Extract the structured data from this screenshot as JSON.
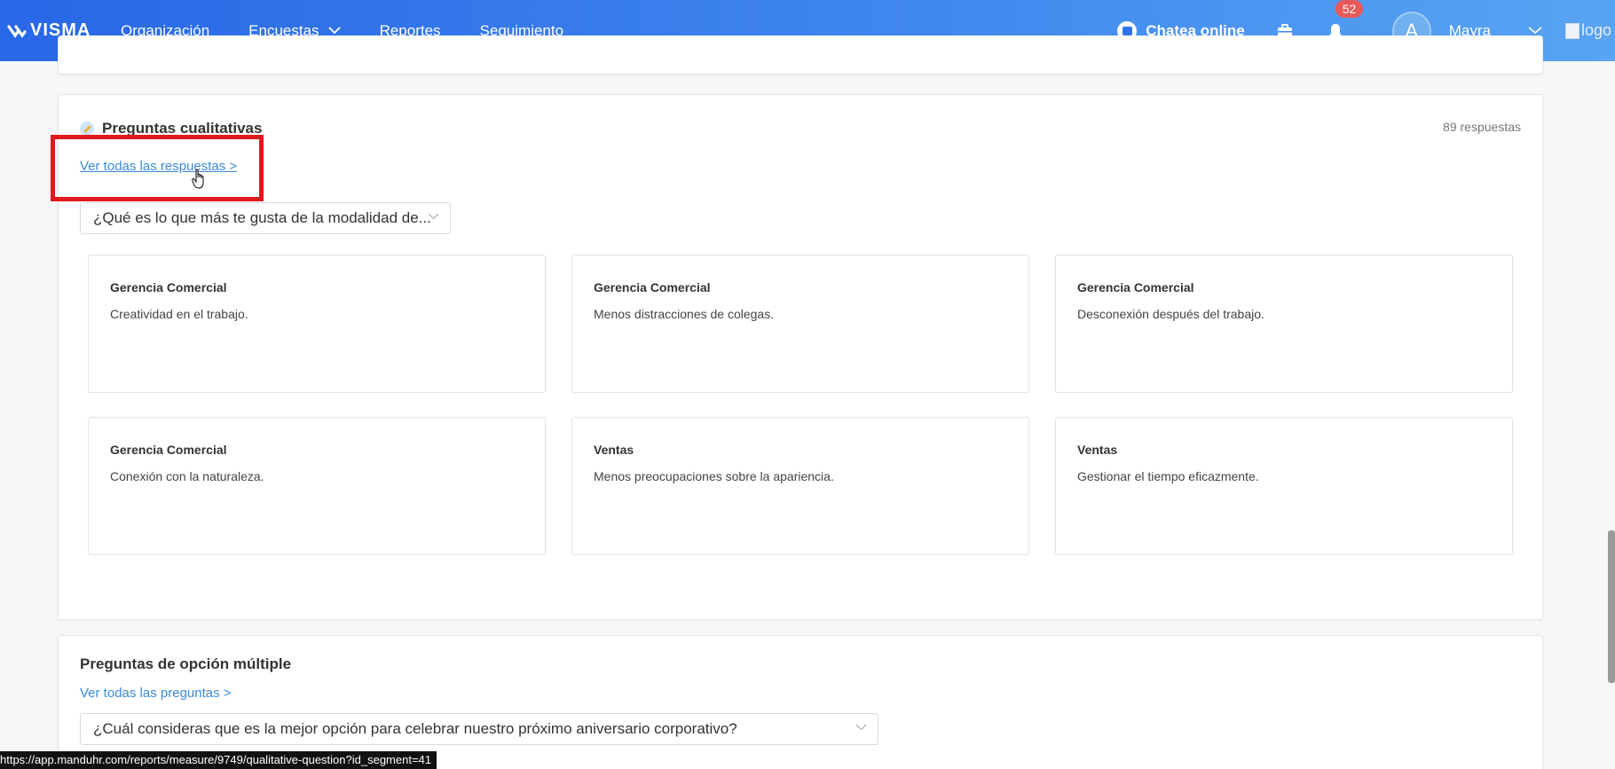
{
  "nav": {
    "brand": "VISMA",
    "items": [
      {
        "label": "Organización",
        "has_dropdown": false
      },
      {
        "label": "Encuestas",
        "has_dropdown": true
      },
      {
        "label": "Reportes",
        "has_dropdown": false
      },
      {
        "label": "Seguimiento",
        "has_dropdown": false
      }
    ],
    "chat_label": "Chatea online",
    "notification_count": "52",
    "avatar_initial": "A",
    "user_name": "Mayra",
    "logo_alt": "logo"
  },
  "qualitative": {
    "title": "Preguntas cualitativas",
    "count": "89 respuestas",
    "link": "Ver todas las respuestas >",
    "question": "¿Qué es lo que más te gusta de la modalidad de...",
    "answers": [
      {
        "dept": "Gerencia Comercial",
        "text": "Creatividad en el trabajo."
      },
      {
        "dept": "Gerencia Comercial",
        "text": "Menos distracciones de colegas."
      },
      {
        "dept": "Gerencia Comercial",
        "text": "Desconexión después del trabajo."
      },
      {
        "dept": "Gerencia Comercial",
        "text": "Conexión con la naturaleza."
      },
      {
        "dept": "Ventas",
        "text": "Menos preocupaciones sobre la apariencia."
      },
      {
        "dept": "Ventas",
        "text": "Gestionar el tiempo eficazmente."
      }
    ]
  },
  "multiple": {
    "title": "Preguntas de opción múltiple",
    "link": "Ver todas las preguntas >",
    "question": "¿Cuál consideras que es la mejor opción para celebrar nuestro próximo aniversario corporativo?"
  },
  "status_url": "https://app.manduhr.com/reports/measure/9749/qualitative-question?id_segment=41",
  "colors": {
    "accent": "#3b8ad9",
    "nav_start": "#2867e6",
    "highlight": "#e0191f"
  }
}
